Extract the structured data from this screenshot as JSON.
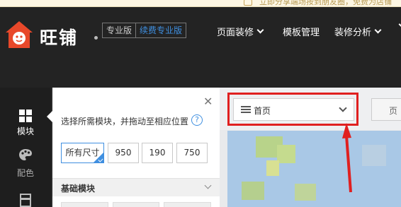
{
  "notice": {
    "text": "立即分享端场按到朋友圈，免费为店铺",
    "icon": "bell-icon"
  },
  "header": {
    "brand": "旺铺",
    "edition": "专业版",
    "renew": "续费专业版",
    "nav": [
      {
        "label": "页面装修",
        "has_dropdown": true
      },
      {
        "label": "模板管理",
        "has_dropdown": false
      },
      {
        "label": "装修分析",
        "has_dropdown": true
      }
    ]
  },
  "rail": {
    "items": [
      {
        "label": "模块",
        "icon": "grid-icon",
        "active": true
      },
      {
        "label": "配色",
        "icon": "palette-icon",
        "active": false
      },
      {
        "label": "",
        "icon": "layout-icon",
        "active": false
      }
    ]
  },
  "panel": {
    "hint": "选择所需模块，并拖动至相应位置",
    "sizes": [
      "所有尺寸",
      "950",
      "190",
      "750"
    ],
    "selected_size": "所有尺寸",
    "section_title": "基础模块"
  },
  "canvas": {
    "page_select": "首页",
    "right_button": "页"
  },
  "colors": {
    "accent": "#3f8fe0",
    "highlight": "#e02020",
    "header_bg": "#232323",
    "logo": "#e8482a"
  }
}
